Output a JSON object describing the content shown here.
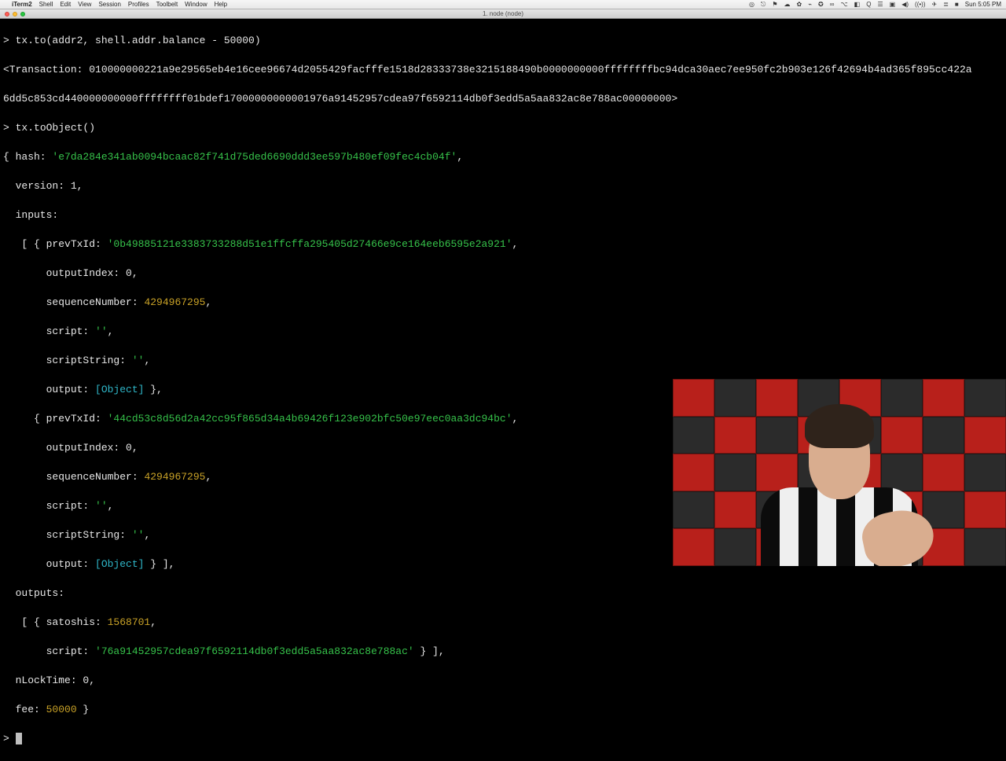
{
  "menubar": {
    "apple": "",
    "app": "iTerm2",
    "items": [
      "Shell",
      "Edit",
      "View",
      "Session",
      "Profiles",
      "Toolbelt",
      "Window",
      "Help"
    ],
    "right_icons": [
      "◎",
      "⎋",
      "⚑",
      "☁︎",
      "✿",
      "⌁",
      "✪",
      "∞",
      "⌥",
      "◧",
      "Q",
      "☰",
      "▣",
      "◀︎)",
      "((•))",
      "✈︎",
      "≣",
      "■"
    ],
    "clock": "Sun 5:05 PM"
  },
  "window": {
    "title": "1. node (node)"
  },
  "terminal": {
    "line1_cmd": "tx.to(addr2, shell.addr.balance - 50000)",
    "line2_prefix": "<Transaction: ",
    "line2_hex": "010000000221a9e29565eb4e16cee96674d2055429facfffe1518d28333738e3215188490b0000000000ffffffffbc94dca30aec7ee950fc2b903e126f42694b4ad365f895cc422a",
    "line3_hex": "6dd5c853cd440000000000ffffffff01bdef17000000000001976a91452957cdea97f6592114db0f3edd5a5aa832ac8e788ac00000000>",
    "line4_cmd": "tx.toObject()",
    "obj": {
      "hash_label": "{ hash: ",
      "hash": "'e7da284e341ab0094bcaac82f741d75ded6690ddd3ee597b480ef09fec4cb04f'",
      "hash_tail": ",",
      "version": "  version: 1,",
      "inputs_label": "  inputs:",
      "in_open": "   [ { prevTxId: ",
      "in0_prev": "'0b49885121e3383733288d51e1ffcffa295405d27466e9ce164eeb6595e2a921'",
      "in0_tail": ",",
      "in0_outIdx": "       outputIndex: 0,",
      "in0_seq_label": "       sequenceNumber: ",
      "in0_seq_val": "4294967295",
      "in0_seq_tail": ",",
      "in0_script_label": "       script: ",
      "in0_script_val": "''",
      "in0_script_tail": ",",
      "in0_sstr_label": "       scriptString: ",
      "in0_sstr_val": "''",
      "in0_sstr_tail": ",",
      "in0_out_label": "       output: ",
      "in0_out_val": "[Object]",
      "in0_out_tail": " },",
      "in1_open": "     { prevTxId: ",
      "in1_prev": "'44cd53c8d56d2a42cc95f865d34a4b69426f123e902bfc50e97eec0aa3dc94bc'",
      "in1_tail": ",",
      "in1_outIdx": "       outputIndex: 0,",
      "in1_seq_label": "       sequenceNumber: ",
      "in1_seq_val": "4294967295",
      "in1_seq_tail": ",",
      "in1_script_label": "       script: ",
      "in1_script_val": "''",
      "in1_script_tail": ",",
      "in1_sstr_label": "       scriptString: ",
      "in1_sstr_val": "''",
      "in1_sstr_tail": ",",
      "in1_out_label": "       output: ",
      "in1_out_val": "[Object]",
      "in1_out_tail": " } ],",
      "outputs_label": "  outputs:",
      "out_open": "   [ { satoshis: ",
      "out_sat": "1568701",
      "out_sat_tail": ",",
      "out_script_label": "       script: ",
      "out_script_val": "'76a91452957cdea97f6592114db0f3edd5a5aa832ac8e788ac'",
      "out_script_tail": " } ],",
      "nlock": "  nLockTime: 0,",
      "fee_label": "  fee: ",
      "fee_val": "50000",
      "fee_tail": " }"
    },
    "prompt": "> "
  }
}
